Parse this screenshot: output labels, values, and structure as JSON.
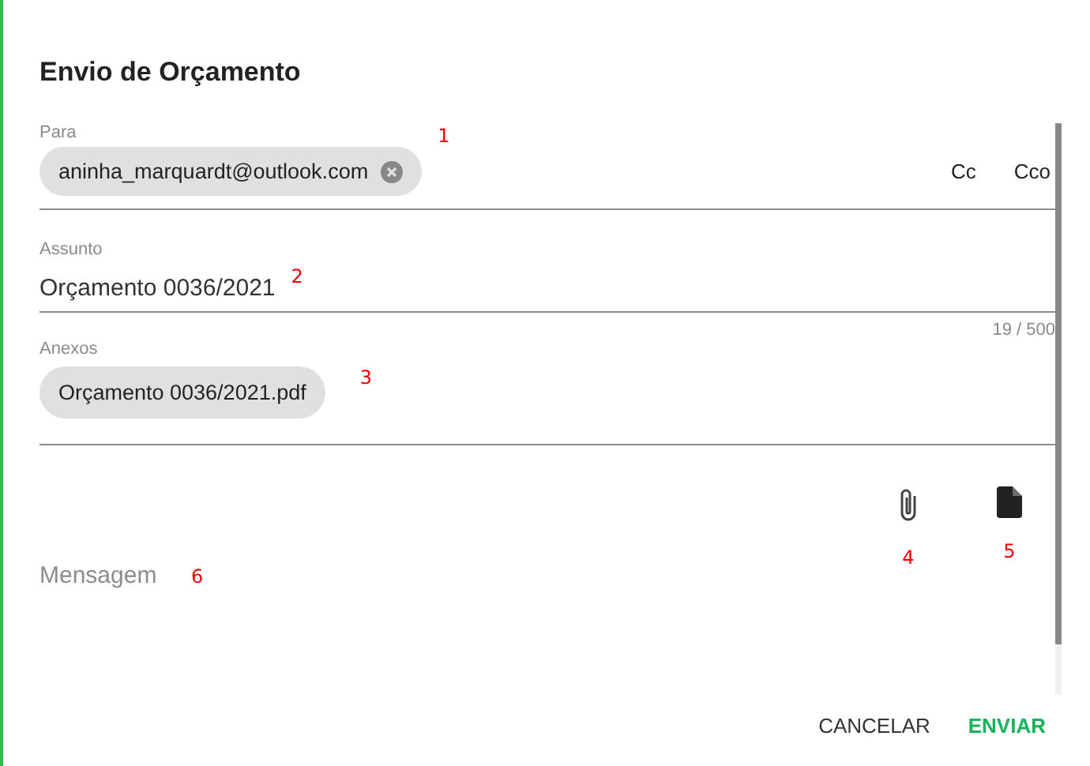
{
  "dialog": {
    "title": "Envio de Orçamento"
  },
  "to": {
    "label": "Para",
    "chips": [
      {
        "text": "aninha_marquardt@outlook.com"
      }
    ],
    "annotation": "1",
    "links": [
      "Cc",
      "Cco"
    ]
  },
  "subject": {
    "label": "Assunto",
    "value": "Orçamento 0036/2021",
    "annotation": "2",
    "counter": "19 / 500"
  },
  "attachments": {
    "label": "Anexos",
    "chips": [
      {
        "text": "Orçamento 0036/2021.pdf"
      }
    ],
    "annotation": "3"
  },
  "tools": [
    {
      "kind": "attach",
      "annotation": "4"
    },
    {
      "kind": "document",
      "annotation": "5"
    }
  ],
  "message": {
    "placeholder": "Mensagem",
    "annotation": "6"
  },
  "buttons": [
    {
      "label": "CANCELAR",
      "kind": "text"
    },
    {
      "label": "ENVIAR",
      "kind": "primary"
    }
  ]
}
